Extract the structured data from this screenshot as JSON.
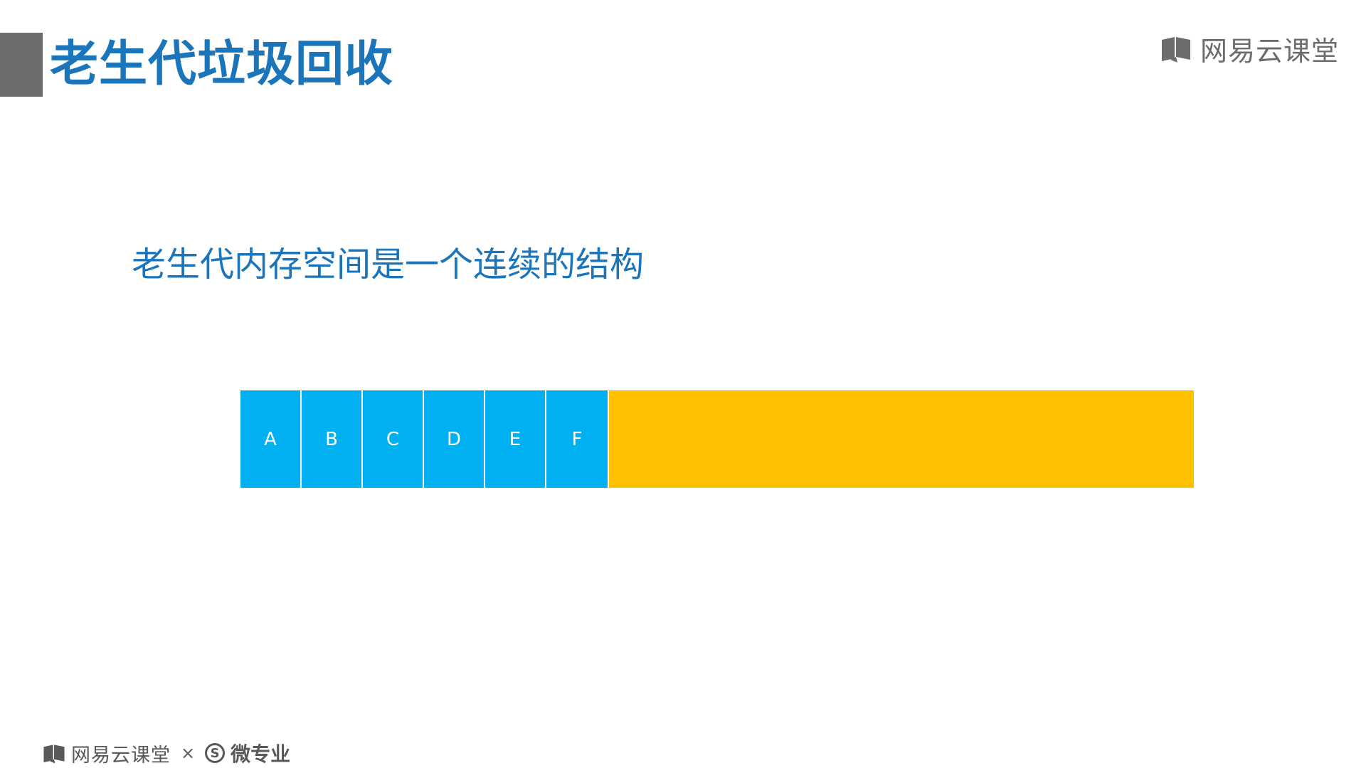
{
  "header": {
    "title": "老生代垃圾回收",
    "brand": "网易云课堂"
  },
  "body": {
    "subtitle": "老生代内存空间是一个连续的结构"
  },
  "diagram": {
    "blocks": [
      "A",
      "B",
      "C",
      "D",
      "E",
      "F"
    ],
    "colors": {
      "used": "#00b0f0",
      "free": "#ffc000",
      "title": "#1b75bb"
    }
  },
  "footer": {
    "brand": "网易云课堂",
    "separator": "×",
    "badge": "S",
    "program": "微专业"
  }
}
